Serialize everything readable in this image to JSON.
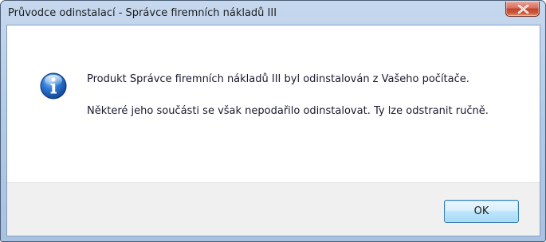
{
  "window": {
    "title": "Průvodce odinstalací - Správce firemních nákladů III"
  },
  "dialog": {
    "icon": "info-icon",
    "message_line1": "Produkt Správce firemních nákladů III byl odinstalován z Vašeho počítače.",
    "message_line2": "Některé jeho součásti se však nepodařilo odinstalovat. Ty lze odstranit ručně."
  },
  "buttons": {
    "ok_label": "OK",
    "close_icon": "close-icon"
  },
  "colors": {
    "title_bar": "#b4cbe6",
    "close_button": "#c2432d",
    "info_icon": "#1f63b8",
    "footer": "#f0f0f0",
    "ok_border": "#3c7fb1"
  }
}
